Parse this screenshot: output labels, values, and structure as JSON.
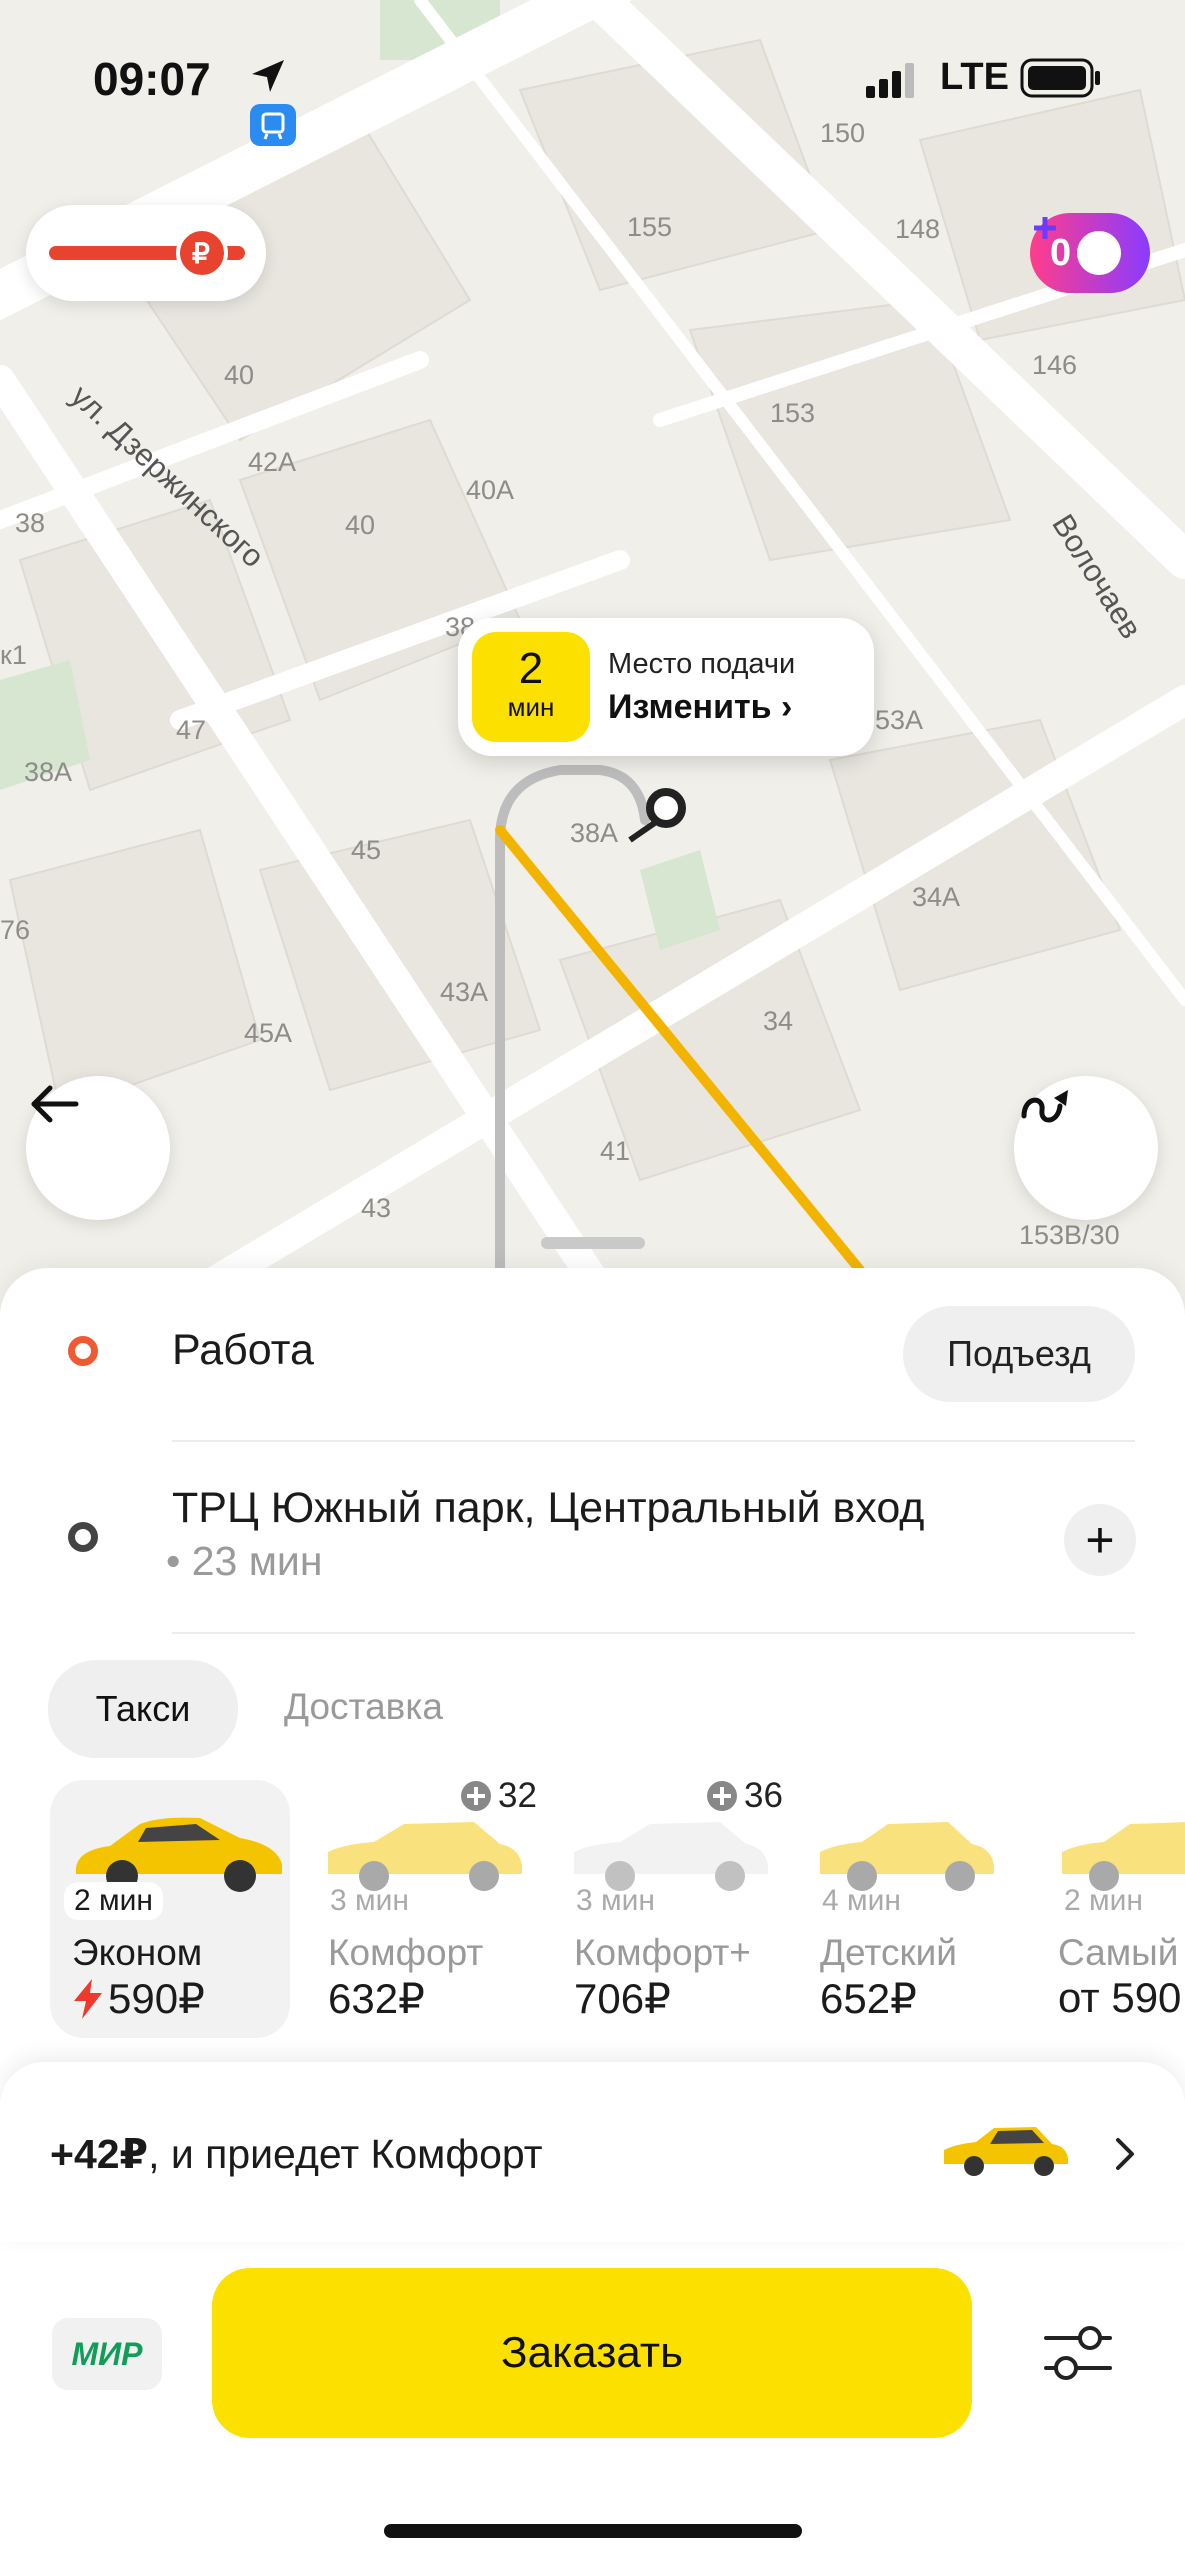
{
  "status_bar": {
    "time": "09:07",
    "network": "LTE"
  },
  "map": {
    "streets": [
      "ул. Дзержинского",
      "Волочаев"
    ],
    "house_numbers": [
      "150",
      "155",
      "148",
      "146",
      "153",
      "40",
      "42А",
      "40А",
      "38",
      "40",
      "38",
      "47",
      "38А",
      "45",
      "38А",
      "53А",
      "34А",
      "76",
      "43А",
      "45А",
      "34",
      "41",
      "43",
      "153В/30",
      "к1"
    ],
    "promo_counter": "0",
    "pickup": {
      "eta_value": "2",
      "eta_unit": "мин",
      "title": "Место подачи",
      "change_label": "Изменить",
      "change_chevron": "›"
    }
  },
  "route": {
    "from": {
      "label": "Работа",
      "entrance_button": "Подъезд"
    },
    "to": {
      "label": "ТРЦ Южный парк, Центральный вход",
      "duration": "• 23 мин",
      "add_button": "+"
    }
  },
  "tabs": [
    {
      "label": "Такси",
      "selected": true
    },
    {
      "label": "Доставка",
      "selected": false
    }
  ],
  "tariffs": [
    {
      "eta": "2 мин",
      "name": "Эконом",
      "price": "590₽",
      "selected": true,
      "bonus": ""
    },
    {
      "eta": "3 мин",
      "name": "Комфорт",
      "price": "632₽",
      "selected": false,
      "bonus": "32"
    },
    {
      "eta": "3 мин",
      "name": "Комфорт+",
      "price": "706₽",
      "selected": false,
      "bonus": "36"
    },
    {
      "eta": "4 мин",
      "name": "Детский",
      "price": "652₽",
      "selected": false,
      "bonus": ""
    },
    {
      "eta": "2 мин",
      "name": "Самый",
      "price": "от 590",
      "selected": false,
      "bonus": ""
    }
  ],
  "upgrade": {
    "amount": "+42₽",
    "text": ", и приедет Комфорт"
  },
  "order_button": "Заказать",
  "payment": {
    "card_label": "МИР"
  },
  "colors": {
    "accent_yellow": "#fce000",
    "route_line": "#f3b400",
    "origin_ring": "#ef5a32",
    "promo_gradient_start": "#ff3d8b",
    "promo_gradient_end": "#8a3cff"
  },
  "icons": [
    "navigation-arrow-icon",
    "transit-badge-icon",
    "signal-icon",
    "battery-icon",
    "toll-road-icon",
    "plus-points-icon",
    "back-arrow-icon",
    "route-variants-icon",
    "chevron-right-icon",
    "settings-sliders-icon",
    "flash-icon"
  ]
}
